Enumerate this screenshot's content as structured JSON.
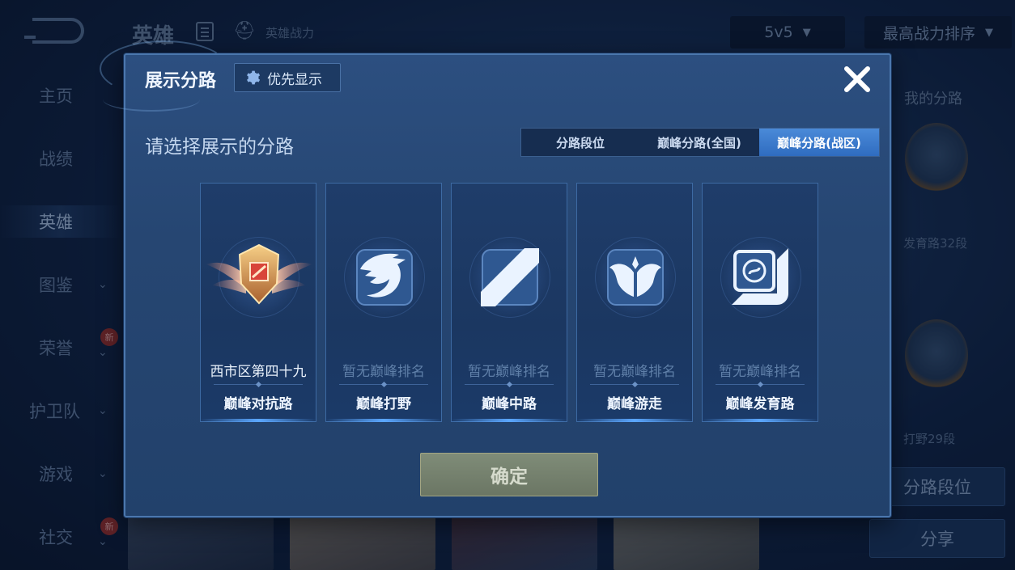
{
  "background": {
    "top_title": "英雄",
    "top_subtitle": "英雄战力",
    "mode_dropdown": "5v5",
    "sort_dropdown": "最高战力排序",
    "nav": [
      {
        "label": "主页",
        "active": false,
        "chevron": false,
        "badge": ""
      },
      {
        "label": "战绩",
        "active": false,
        "chevron": false,
        "badge": ""
      },
      {
        "label": "英雄",
        "active": true,
        "chevron": false,
        "badge": ""
      },
      {
        "label": "图鉴",
        "active": false,
        "chevron": true,
        "badge": ""
      },
      {
        "label": "荣誉",
        "active": false,
        "chevron": true,
        "badge": "新"
      },
      {
        "label": "护卫队",
        "active": false,
        "chevron": true,
        "badge": ""
      },
      {
        "label": "游戏",
        "active": false,
        "chevron": true,
        "badge": ""
      },
      {
        "label": "社交",
        "active": false,
        "chevron": true,
        "badge": "新"
      }
    ],
    "right_panel": {
      "title": "我的分路",
      "lane1_caption": "发育路32段",
      "lane2_caption": "打野29段",
      "btn_lane_rank": "分路段位",
      "btn_share": "分享"
    }
  },
  "modal": {
    "title": "展示分路",
    "priority_label": "优先显示",
    "subtitle": "请选择展示的分路",
    "tabs": [
      {
        "label": "分路段位",
        "selected": false
      },
      {
        "label": "巅峰分路(全国)",
        "selected": false
      },
      {
        "label": "巅峰分路(战区)",
        "selected": true
      }
    ],
    "cards": [
      {
        "rank": "西市区第四十九",
        "role": "巅峰对抗路",
        "icon": "clash-lane-medal-icon"
      },
      {
        "rank": "暂无巅峰排名",
        "role": "巅峰打野",
        "icon": "jungle-dragon-icon"
      },
      {
        "rank": "暂无巅峰排名",
        "role": "巅峰中路",
        "icon": "mid-lane-slash-icon"
      },
      {
        "rank": "暂无巅峰排名",
        "role": "巅峰游走",
        "icon": "roam-wings-icon"
      },
      {
        "rank": "暂无巅峰排名",
        "role": "巅峰发育路",
        "icon": "farm-lane-icon"
      }
    ],
    "confirm_label": "确定"
  },
  "colors": {
    "modal_bg": "#264672",
    "selected_tab": "#3a7bd0",
    "confirm_btn": "#758070"
  }
}
